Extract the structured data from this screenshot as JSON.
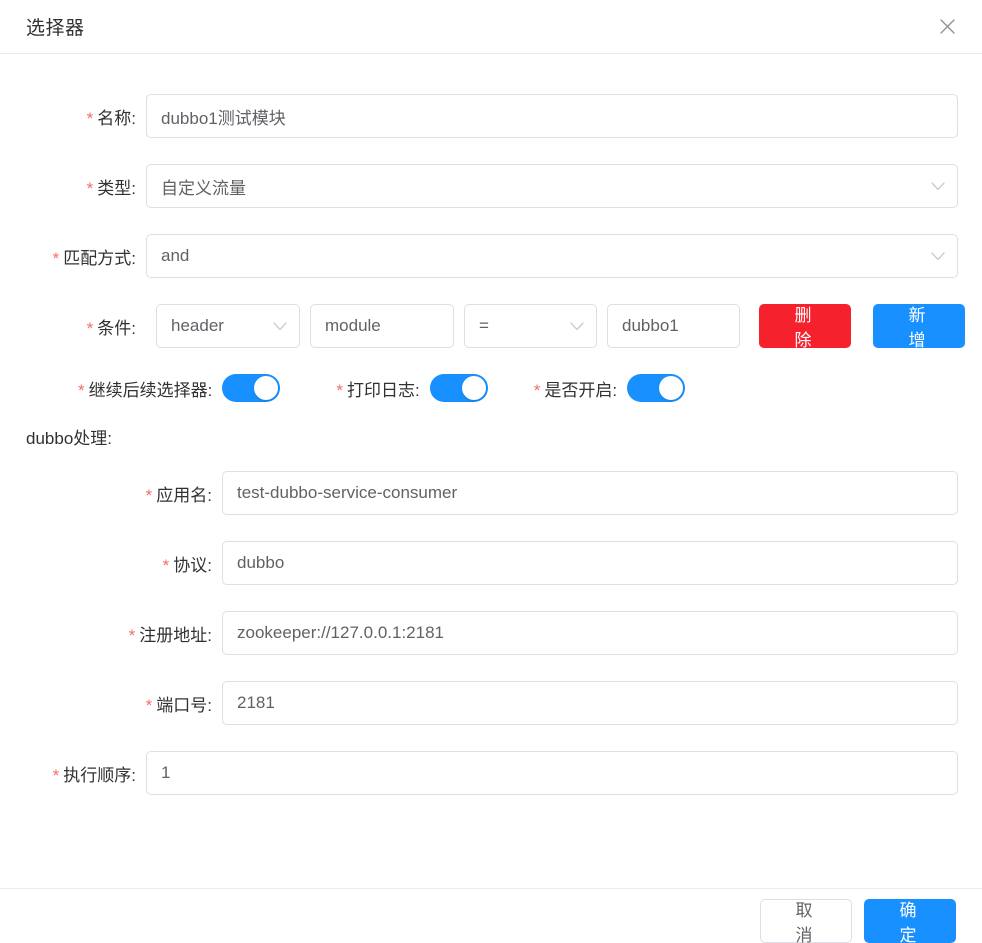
{
  "dialog": {
    "title": "选择器",
    "close_icon": "close-icon"
  },
  "form": {
    "name": {
      "label": "名称:",
      "required_mark": "*",
      "value": "dubbo1测试模块"
    },
    "type": {
      "label": "类型:",
      "required_mark": "*",
      "value": "自定义流量",
      "chevron": "chevron-down-icon"
    },
    "match_mode": {
      "label": "匹配方式:",
      "required_mark": "*",
      "value": "and",
      "chevron": "chevron-down-icon"
    },
    "condition": {
      "label": "条件:",
      "required_mark": "*",
      "source": "header",
      "key": "module",
      "operator": "=",
      "value": "dubbo1",
      "delete_label": "删 除",
      "add_label": "新 增"
    },
    "switches": [
      {
        "label": "继续后续选择器:",
        "required_mark": "*",
        "on": true
      },
      {
        "label": "打印日志:",
        "required_mark": "*",
        "on": true
      },
      {
        "label": "是否开启:",
        "required_mark": "*",
        "on": true
      }
    ],
    "dubbo_section_title": "dubbo处理:",
    "app_name": {
      "label": "应用名:",
      "required_mark": "*",
      "value": "test-dubbo-service-consumer"
    },
    "protocol": {
      "label": "协议:",
      "required_mark": "*",
      "value": "dubbo"
    },
    "registry_address": {
      "label": "注册地址:",
      "required_mark": "*",
      "value": "zookeeper://127.0.0.1:2181"
    },
    "port": {
      "label": "端口号:",
      "required_mark": "*",
      "value": "2181"
    },
    "sort_order": {
      "label": "执行顺序:",
      "required_mark": "*",
      "value": "1"
    }
  },
  "footer": {
    "cancel_label": "取 消",
    "confirm_label": "确 定"
  },
  "colors": {
    "primary": "#1890ff",
    "danger": "#f5222d",
    "required": "#f56c6c",
    "border": "#dcdfe6",
    "text": "#303133",
    "value_text": "#606266"
  }
}
